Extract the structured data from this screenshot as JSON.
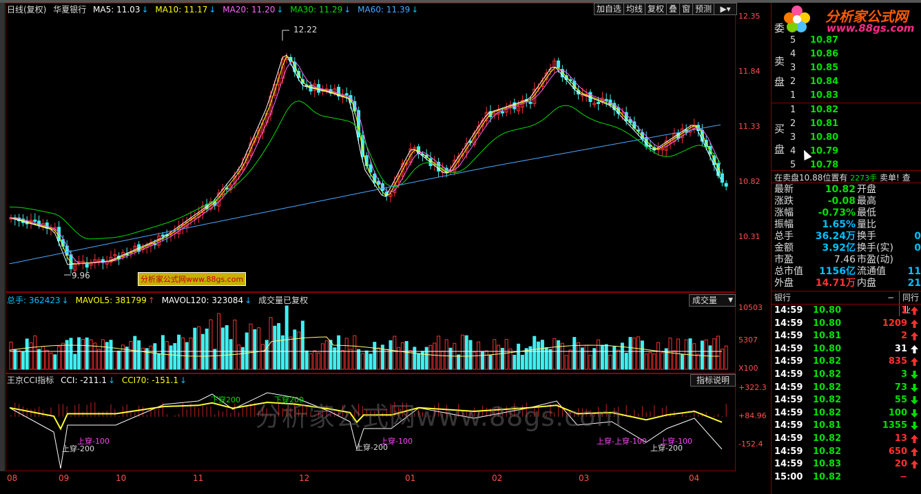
{
  "header": {
    "period": "日线(复权)",
    "stock": "华夏银行",
    "ma5": "MA5: 11.03",
    "ma10": "MA10: 11.17",
    "ma20": "MA20: 11.20",
    "ma30": "MA30: 11.29",
    "ma60": "MA60: 11.39",
    "colors": {
      "ma5": "#ffffff",
      "ma10": "#ffff00",
      "ma20": "#ff66ff",
      "ma30": "#00e000",
      "ma60": "#4aa8ff"
    }
  },
  "toolbar": {
    "add": "加自选",
    "avg": "均线",
    "fq": "复权",
    "overlay": "叠",
    "window": "窗",
    "predict": "预测"
  },
  "price_axis": [
    "12.35",
    "11.84",
    "11.33",
    "10.82",
    "10.31"
  ],
  "high_label": "12.22",
  "low_label": "9.96",
  "watermark": "分析家公式网www.88gs.com",
  "watermark_big": "分析家公式网www.88gs.com",
  "logo": {
    "name": "分析家公式网",
    "url": "www.88gs.com"
  },
  "volume": {
    "total": "总手: 362423",
    "mavol5": "MAVOL5: 381799",
    "mavol120": "MAVOL120: 323084",
    "note": "成交量已复权",
    "dropdown": "成交量",
    "axis": [
      "10503",
      "5307",
      "X100"
    ]
  },
  "cci": {
    "name": "王京CCI指标",
    "cci": "CCI: -211.1",
    "cci70": "CCI70: -151.1",
    "button": "指标说明",
    "axis": [
      "+322.3",
      "+84.96",
      "-152.4"
    ],
    "labels": [
      "下穿200",
      "下穿200",
      "上穿-100",
      "上穿-200",
      "上穿-100",
      "上穿-200",
      "上穿-上穿-100",
      "上穿-100",
      "上穿-200"
    ]
  },
  "months": [
    "08",
    "09",
    "10",
    "11",
    "12",
    "01",
    "02",
    "03",
    "04"
  ],
  "orderbook": {
    "title_wei": "委",
    "sell_label": [
      "卖",
      "盘"
    ],
    "buy_label": [
      "买",
      "盘"
    ],
    "sell": [
      {
        "n": "5",
        "p": "10.87"
      },
      {
        "n": "4",
        "p": "10.86"
      },
      {
        "n": "3",
        "p": "10.85"
      },
      {
        "n": "2",
        "p": "10.84"
      },
      {
        "n": "1",
        "p": "10.83"
      }
    ],
    "buy": [
      {
        "n": "1",
        "p": "10.82"
      },
      {
        "n": "2",
        "p": "10.81"
      },
      {
        "n": "3",
        "p": "10.80"
      },
      {
        "n": "4",
        "p": "10.79"
      },
      {
        "n": "5",
        "p": "10.78"
      }
    ],
    "status_a": "在卖盘10.88位置有",
    "status_b": "2273手",
    "status_c": "卖单! 查"
  },
  "quote": [
    {
      "k": "最新",
      "v": "10.82",
      "vc": "g",
      "k2": "开盘"
    },
    {
      "k": "涨跌",
      "v": "-0.08",
      "vc": "g",
      "k2": "最高"
    },
    {
      "k": "涨幅",
      "v": "-0.73%",
      "vc": "g",
      "k2": "最低"
    },
    {
      "k": "振幅",
      "v": "1.65%",
      "vc": "c",
      "k2": "量比"
    },
    {
      "k": "总手",
      "v": "36.24万",
      "vc": "c",
      "k2": "换手"
    },
    {
      "k": "金额",
      "v": "3.92亿",
      "vc": "c",
      "k2": "换手(实)"
    },
    {
      "k": "市盈",
      "v": "7.46",
      "vc": "vl",
      "k2": "市盈(动)"
    },
    {
      "k": "总市值",
      "v": "1156亿",
      "vc": "c",
      "k2": "流通值"
    },
    {
      "k": "外盘",
      "v": "14.71万",
      "vc": "r",
      "k2": "内盘"
    }
  ],
  "quote_right_fragments": [
    "",
    "",
    "",
    "",
    "0",
    "0",
    "",
    "11",
    "21"
  ],
  "ticks_header": {
    "industry": "银行",
    "dash": "−",
    "peer": "同行业"
  },
  "ticks": [
    {
      "t": "14:59",
      "p": "10.80",
      "v": "1",
      "dir": "up"
    },
    {
      "t": "14:59",
      "p": "10.80",
      "v": "1209",
      "dir": "up"
    },
    {
      "t": "14:59",
      "p": "10.81",
      "v": "2",
      "dir": "up"
    },
    {
      "t": "14:59",
      "p": "10.80",
      "v": "31",
      "dir": "upw"
    },
    {
      "t": "14:59",
      "p": "10.82",
      "v": "835",
      "dir": "up"
    },
    {
      "t": "14:59",
      "p": "10.82",
      "v": "3",
      "dir": "down"
    },
    {
      "t": "14:59",
      "p": "10.82",
      "v": "73",
      "dir": "down"
    },
    {
      "t": "14:59",
      "p": "10.82",
      "v": "55",
      "dir": "down"
    },
    {
      "t": "14:59",
      "p": "10.82",
      "v": "100",
      "dir": "down"
    },
    {
      "t": "14:59",
      "p": "10.81",
      "v": "1355",
      "dir": "down"
    },
    {
      "t": "14:59",
      "p": "10.82",
      "v": "13",
      "dir": "up"
    },
    {
      "t": "14:59",
      "p": "10.82",
      "v": "650",
      "dir": "up"
    },
    {
      "t": "14:59",
      "p": "10.83",
      "v": "20",
      "dir": "up"
    },
    {
      "t": "15:00",
      "p": "10.82",
      "v": "−",
      "dir": "none"
    }
  ]
}
